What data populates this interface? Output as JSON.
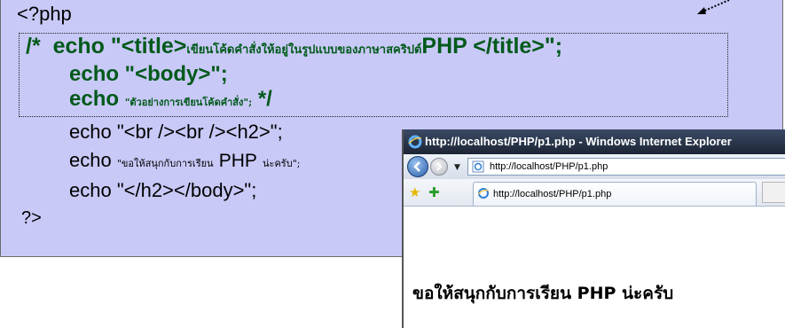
{
  "code": {
    "open_tag": "<?php",
    "line1_prefix": "/*",
    "line1_echo": "echo \"<title>",
    "line1_thai": "เขียนโค้ดคำสั่งให้อยู่ในรูปแบบของภาษาสคริปต์",
    "line1_suffix": "PHP </title>\";",
    "line2": "echo \"<body>\";",
    "line3_echo": "echo",
    "line3_thai": "\"ตัวอย่างการเขียนโค้ดคำสั่ง\";",
    "line3_close": "*/",
    "line4": "echo \"<br /><br /><h2>\";",
    "line5_echo": "echo",
    "line5_thai": "\"ขอให้สนุกกับการเรียน",
    "line5_php": "PHP",
    "line5_end": "น่ะครับ\";",
    "line6": "echo \"</h2></body>\";",
    "close_tag": "?>"
  },
  "browser": {
    "title": "http://localhost/PHP/p1.php - Windows Internet Explorer",
    "address": "http://localhost/PHP/p1.php",
    "tab_label": "http://localhost/PHP/p1.php",
    "page_text": "ขอให้สนุกกับการเรียน PHP น่ะครับ"
  },
  "colors": {
    "panel_bg": "#c9c9f8",
    "comment_green": "#00591a",
    "titlebar": "#1c2534"
  },
  "icons": [
    "ie-icon",
    "back-arrow-icon",
    "forward-arrow-icon",
    "page-icon",
    "favorites-star-icon",
    "add-favorite-icon"
  ]
}
